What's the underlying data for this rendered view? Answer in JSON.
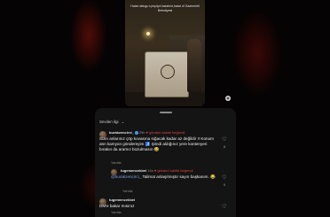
{
  "video": {
    "caption": "Halat oldugu içinçöpü kalabılır,halat of Gaziemirli Belediyesi"
  },
  "sheet": {
    "sort_label": "Sevilen ilgi",
    "comments": [
      {
        "username": "burakzencirci_",
        "time": "29h",
        "flag": "♥ gönderi sahibi beğendi",
        "text": "Sizin anlarınız çöp kovasına sığacak kadar az değildir !! Konum atın kamyon göndereyim 🚮 Şimdi aldığınız yere kontenyeri bırakın da aramız bozulmasın 😂",
        "reply": "Yanıtla",
        "likes": "8"
      },
      {
        "username": "tugemencekbel",
        "time": "16s",
        "flag": "♥ gönderi sahibi beğendi",
        "mention": "@burakzencirci_",
        "text": " Talimat anlaşılmıştır sayın başkanım. 😂",
        "reply": "Yanıtla",
        "likes": "9"
      },
      {
        "username": "tugemencekbel",
        "time": "",
        "text": "DM'e bakar mısınız",
        "reply": "Yanıtla",
        "likes": ""
      }
    ]
  },
  "icons": {
    "heart": "♡",
    "chevron": "⌄"
  }
}
